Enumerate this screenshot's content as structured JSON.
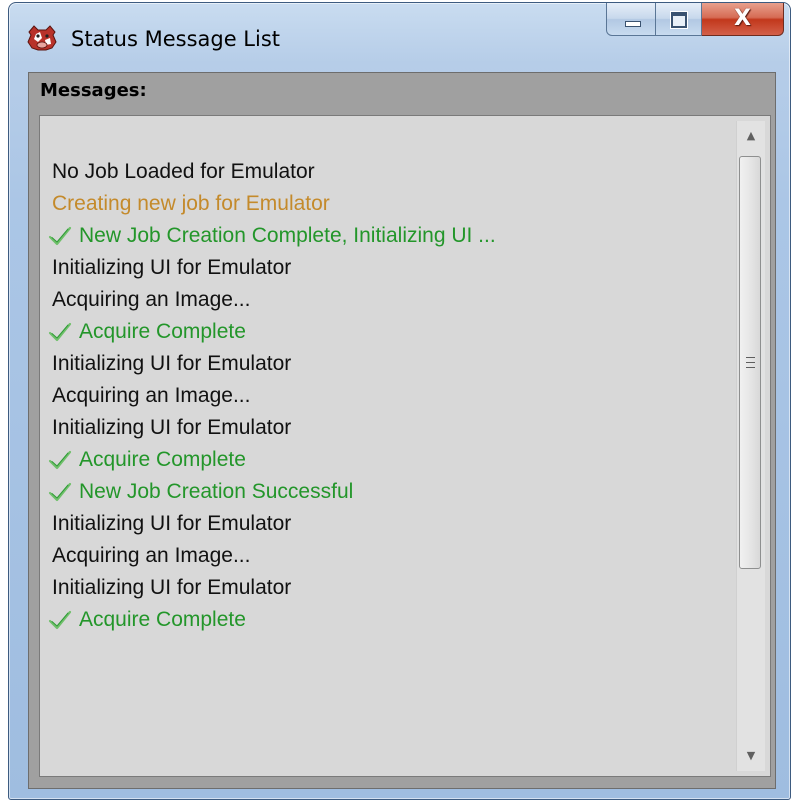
{
  "window": {
    "title": "Status Message List",
    "icon": "cow-app-icon",
    "caption_buttons": {
      "minimize": "minimize-icon",
      "maximize": "maximize-icon",
      "close_glyph": "X"
    }
  },
  "panel": {
    "label": "Messages:"
  },
  "messages": [
    {
      "text": "No Job Loaded for Emulator",
      "type": "plain"
    },
    {
      "text": "Creating new job for Emulator",
      "type": "warn"
    },
    {
      "text": "New Job Creation Complete, Initializing UI ...",
      "type": "success"
    },
    {
      "text": "Initializing UI for Emulator",
      "type": "plain"
    },
    {
      "text": "Acquiring an Image...",
      "type": "plain"
    },
    {
      "text": "Acquire Complete",
      "type": "success"
    },
    {
      "text": "Initializing UI for Emulator",
      "type": "plain"
    },
    {
      "text": "Acquiring an Image...",
      "type": "plain"
    },
    {
      "text": "Initializing UI for Emulator",
      "type": "plain"
    },
    {
      "text": "Acquire Complete",
      "type": "success"
    },
    {
      "text": "New Job Creation Successful",
      "type": "success"
    },
    {
      "text": "Initializing UI for Emulator",
      "type": "plain"
    },
    {
      "text": "Acquiring an Image...",
      "type": "plain"
    },
    {
      "text": "Initializing UI for Emulator",
      "type": "plain"
    },
    {
      "text": "Acquire Complete",
      "type": "success"
    }
  ],
  "colors": {
    "plain": "#111111",
    "warn": "#c48a2b",
    "success": "#23962a",
    "list_background": "#d8d8d8",
    "panel_background": "#a0a0a0"
  },
  "scrollbar": {
    "up_glyph": "▲",
    "down_glyph": "▼"
  }
}
